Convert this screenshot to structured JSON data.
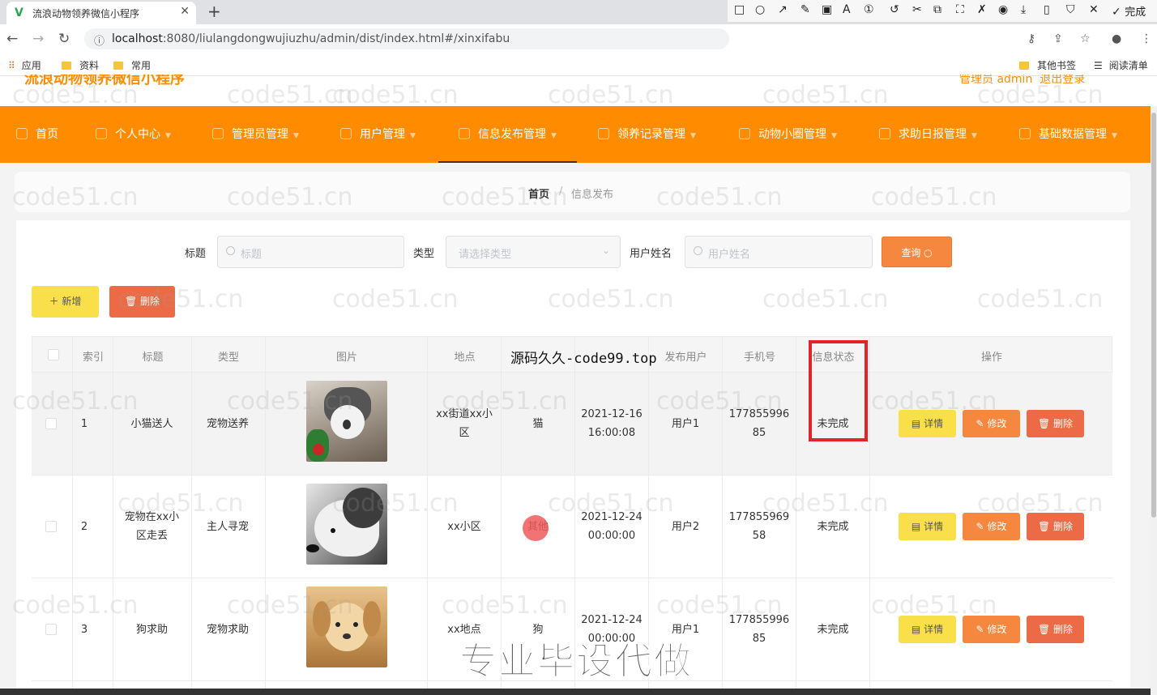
{
  "browser": {
    "tab_title": "流浪动物领养微信小程序",
    "url_host": "localhost",
    "url_rest": ":8080/liulangdongwujiuzhu/admin/dist/index.html#/xinxifabu",
    "bookmarks": [
      "应用",
      "资料",
      "常用"
    ],
    "bookmarks_right": [
      "其他书签",
      "阅读清单"
    ],
    "annot_done": "完成"
  },
  "header": {
    "app_title": "流浪动物领养微信小程序",
    "user": "管理员 admin",
    "logout": "退出登录"
  },
  "menu": [
    {
      "label": "首页"
    },
    {
      "label": "个人中心"
    },
    {
      "label": "管理员管理"
    },
    {
      "label": "用户管理"
    },
    {
      "label": "信息发布管理"
    },
    {
      "label": "领养记录管理"
    },
    {
      "label": "动物小圈管理"
    },
    {
      "label": "求助日报管理"
    },
    {
      "label": "基础数据管理"
    }
  ],
  "breadcrumb": {
    "home": "首页",
    "sep": "/",
    "current": "信息发布"
  },
  "search": {
    "title_label": "标题",
    "title_placeholder": "标题",
    "type_label": "类型",
    "type_placeholder": "请选择类型",
    "user_label": "用户姓名",
    "user_placeholder": "用户姓名",
    "query": "查询"
  },
  "actions": {
    "add": "＋ 新增",
    "delete": "删除"
  },
  "table": {
    "columns": [
      "索引",
      "标题",
      "类型",
      "图片",
      "地点",
      "",
      "",
      "发布用户",
      "手机号",
      "信息状态",
      "操作"
    ],
    "rows": [
      {
        "index": "1",
        "title": "小猫送人",
        "type": "宠物送养",
        "image": "cat",
        "place": "xx街道xx小区",
        "animal": "猫",
        "time": "2021-12-16 16:00:08",
        "user": "用户1",
        "phone": "17785599685",
        "status": "未完成"
      },
      {
        "index": "2",
        "title": "宠物在xx小区走丢",
        "type": "主人寻宠",
        "image": "husky",
        "place": "xx小区",
        "animal": "其他",
        "time": "2021-12-24 00:00:00",
        "user": "用户2",
        "phone": "17785596958",
        "status": "未完成"
      },
      {
        "index": "3",
        "title": "狗求助",
        "type": "宠物求助",
        "image": "puppy",
        "place": "xx地点",
        "animal": "狗",
        "time": "2021-12-24 00:00:00",
        "user": "用户1",
        "phone": "17785599685",
        "status": "未完成"
      }
    ],
    "ops": {
      "detail": "详情",
      "edit": "修改",
      "delete": "删除"
    }
  },
  "overlays": {
    "watermark": "code51.cn",
    "source_text": "源码久久-code99.top",
    "big_text": "专业毕设代做"
  },
  "colors": {
    "accent": "#ff8c00",
    "highlight": "#e0242a"
  }
}
